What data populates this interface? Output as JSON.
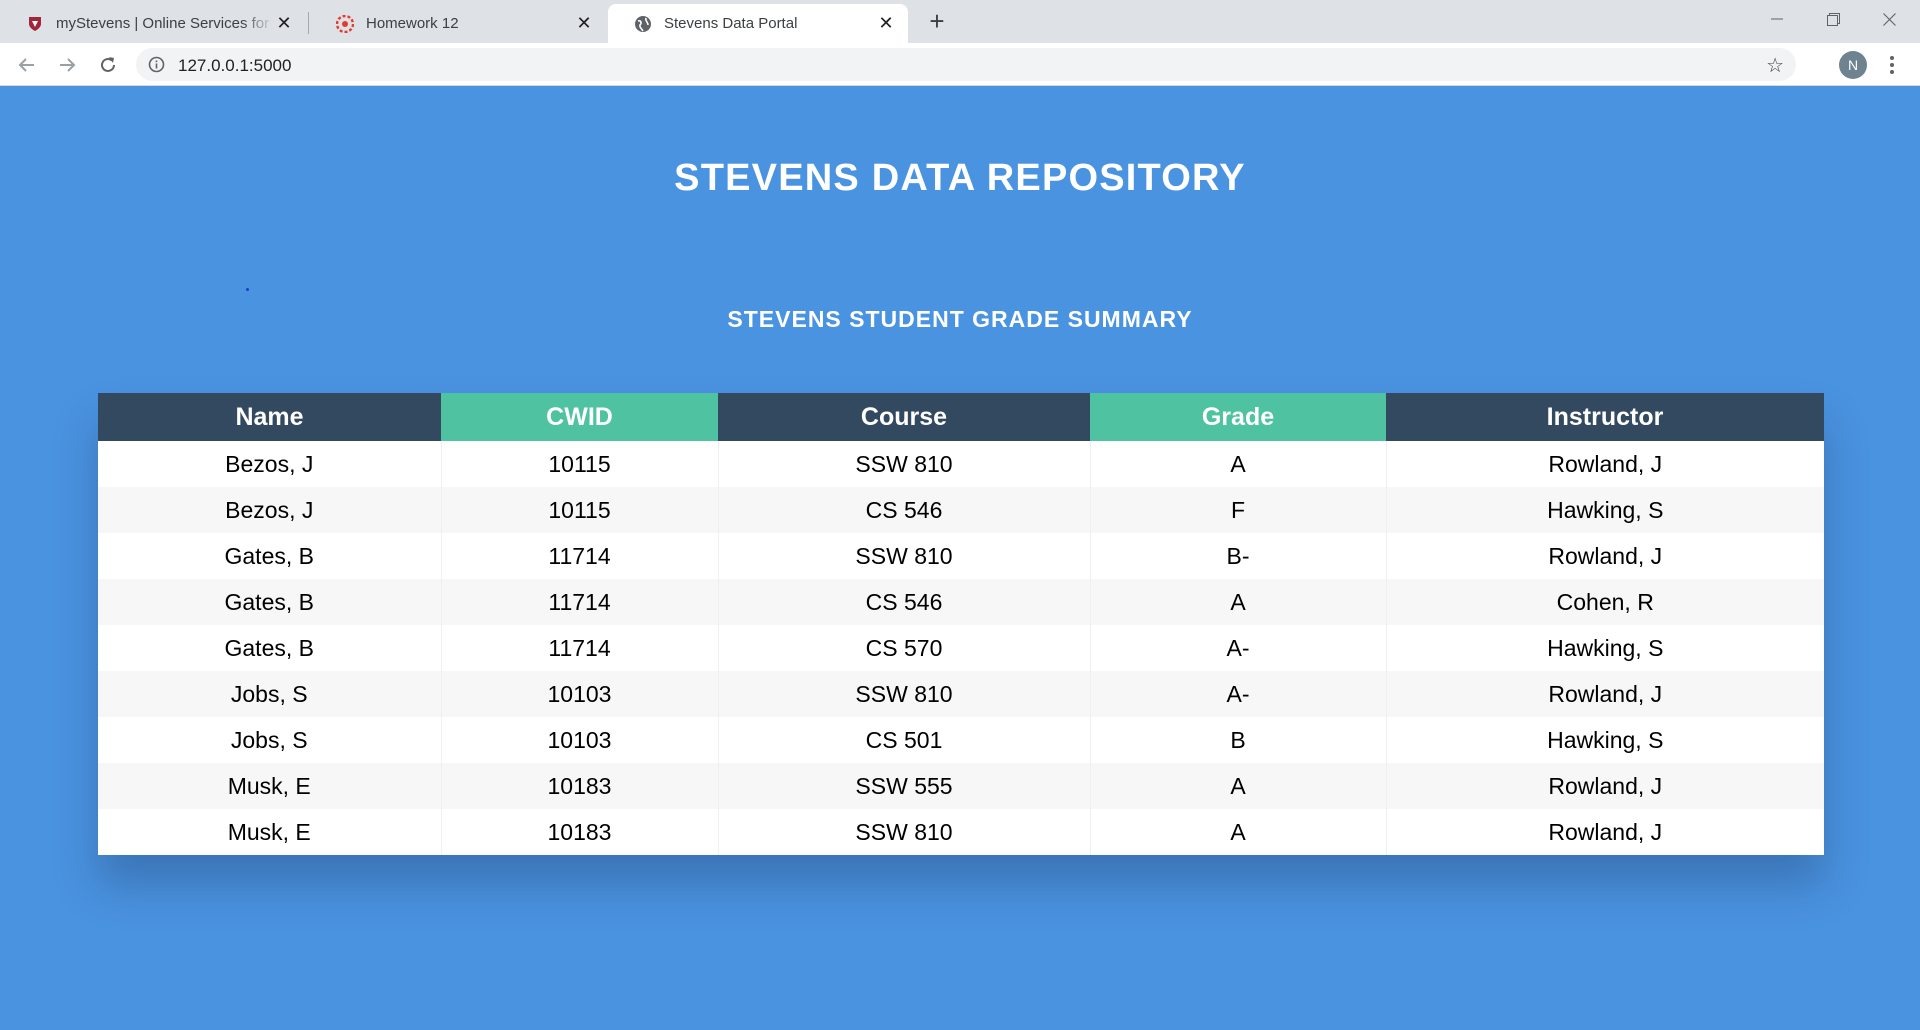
{
  "browser": {
    "tabs": [
      {
        "title": "myStevens | Online Services for the",
        "icon": "stevens-shield-icon"
      },
      {
        "title": "Homework 12",
        "icon": "canvas-icon"
      },
      {
        "title": "Stevens Data Portal",
        "icon": "globe-icon",
        "active": true
      }
    ],
    "url": "127.0.0.1:5000",
    "profile_initial": "N"
  },
  "page": {
    "title": "STEVENS DATA REPOSITORY",
    "subtitle": "STEVENS STUDENT GRADE SUMMARY",
    "table": {
      "headers": [
        "Name",
        "CWID",
        "Course",
        "Grade",
        "Instructor"
      ],
      "rows": [
        [
          "Bezos, J",
          "10115",
          "SSW 810",
          "A",
          "Rowland, J"
        ],
        [
          "Bezos, J",
          "10115",
          "CS 546",
          "F",
          "Hawking, S"
        ],
        [
          "Gates, B",
          "11714",
          "SSW 810",
          "B-",
          "Rowland, J"
        ],
        [
          "Gates, B",
          "11714",
          "CS 546",
          "A",
          "Cohen, R"
        ],
        [
          "Gates, B",
          "11714",
          "CS 570",
          "A-",
          "Hawking, S"
        ],
        [
          "Jobs, S",
          "10103",
          "SSW 810",
          "A-",
          "Rowland, J"
        ],
        [
          "Jobs, S",
          "10103",
          "CS 501",
          "B",
          "Hawking, S"
        ],
        [
          "Musk, E",
          "10183",
          "SSW 555",
          "A",
          "Rowland, J"
        ],
        [
          "Musk, E",
          "10183",
          "SSW 810",
          "A",
          "Rowland, J"
        ]
      ]
    }
  },
  "colors": {
    "page_background": "#4a93e0",
    "header_dark": "#324960",
    "header_green": "#4fc3a1"
  }
}
